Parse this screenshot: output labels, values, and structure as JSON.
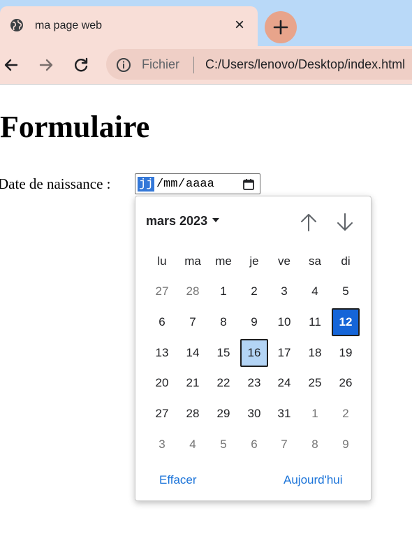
{
  "browser": {
    "tab_title": "ma page web",
    "tab_close": "×",
    "scheme_label": "Fichier",
    "url": "C:/Users/lenovo/Desktop/index.html"
  },
  "page": {
    "title": "Formulaire",
    "field_label": "Date de naissance :",
    "date_input": {
      "day_placeholder": "jj",
      "month_placeholder": "mm",
      "year_placeholder": "aaaa",
      "separator": "/"
    }
  },
  "calendar": {
    "month_label": "mars 2023",
    "weekdays": [
      "lu",
      "ma",
      "me",
      "je",
      "ve",
      "sa",
      "di"
    ],
    "weeks": [
      [
        "27",
        "28",
        "1",
        "2",
        "3",
        "4",
        "5"
      ],
      [
        "6",
        "7",
        "8",
        "9",
        "10",
        "11",
        "12"
      ],
      [
        "13",
        "14",
        "15",
        "16",
        "17",
        "18",
        "19"
      ],
      [
        "20",
        "21",
        "22",
        "23",
        "24",
        "25",
        "26"
      ],
      [
        "27",
        "28",
        "29",
        "30",
        "31",
        "1",
        "2"
      ],
      [
        "3",
        "4",
        "5",
        "6",
        "7",
        "8",
        "9"
      ]
    ],
    "selected_day": "16",
    "today_day": "12",
    "clear_label": "Effacer",
    "today_label": "Aujourd'hui"
  },
  "colors": {
    "accent": "#1565d8",
    "selected_bg": "#b3d4f5",
    "link": "#1a73d9"
  }
}
